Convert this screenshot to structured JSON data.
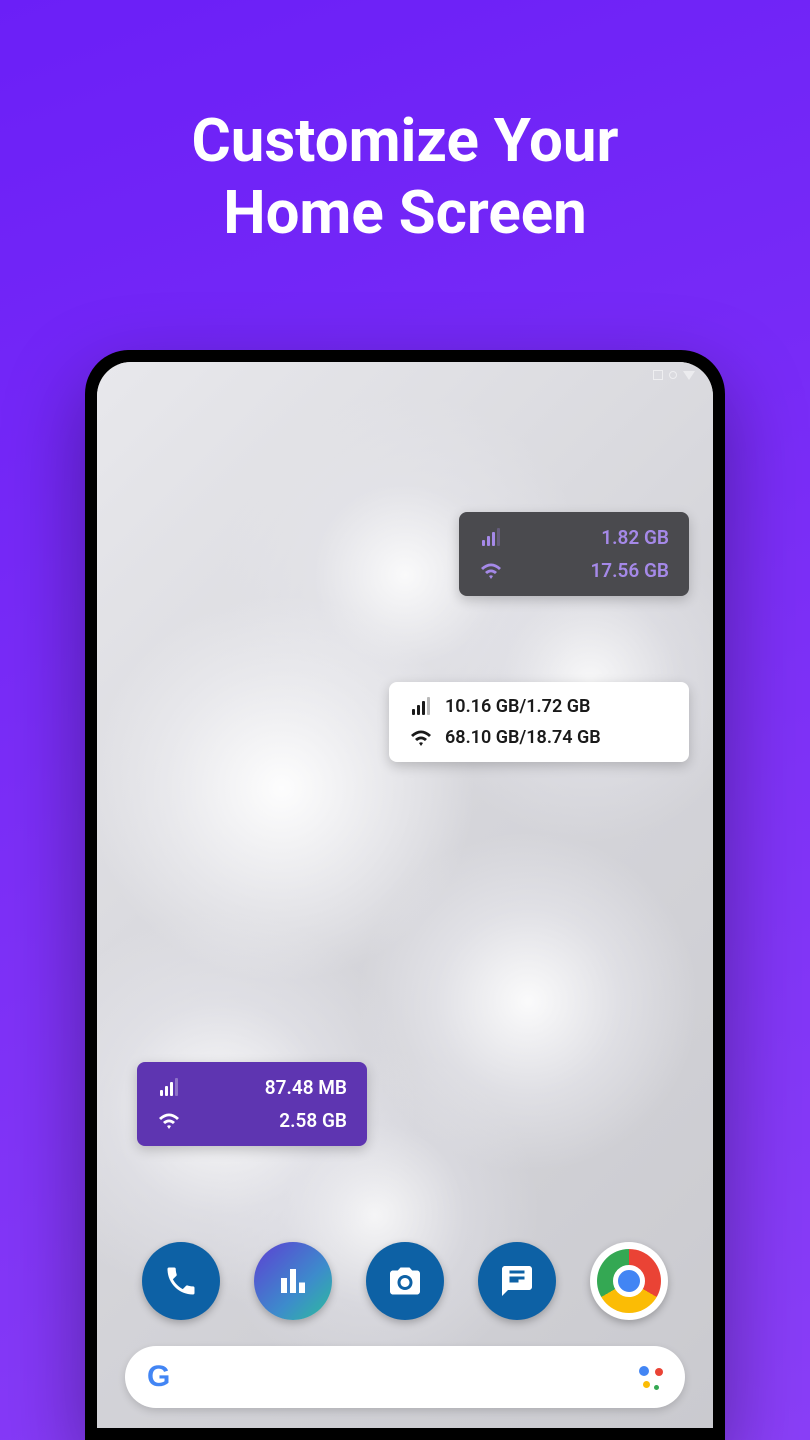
{
  "title": {
    "line1": "Customize Your",
    "line2": "Home Screen"
  },
  "widgets": {
    "dark": {
      "mobile": "1.82 GB",
      "wifi": "17.56 GB"
    },
    "light": {
      "mobile": "10.16 GB/1.72 GB",
      "wifi": "68.10 GB/18.74 GB"
    },
    "purple": {
      "mobile": "87.48 MB",
      "wifi": "2.58 GB"
    }
  },
  "dock": {
    "phone": "Phone",
    "stats": "Data Usage",
    "camera": "Camera",
    "messages": "Messages",
    "chrome": "Chrome"
  },
  "search": {
    "logo": "Google",
    "assistant": "Assistant"
  }
}
